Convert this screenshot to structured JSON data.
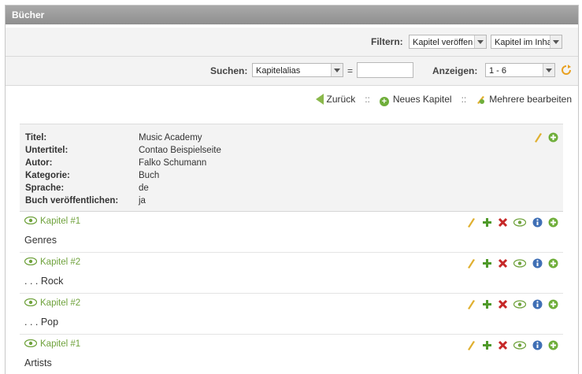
{
  "window": {
    "title": "Bücher"
  },
  "filter": {
    "label": "Filtern:",
    "select1": "Kapitel veröffen",
    "select2": "Kapitel im Inhalt"
  },
  "search": {
    "label": "Suchen:",
    "field_select": "Kapitelalias",
    "equals": "=",
    "value": "",
    "show_label": "Anzeigen:",
    "show_select": "1 - 6"
  },
  "nav": {
    "back": "Zurück",
    "sep1": "::",
    "new_chapter": "Neues Kapitel",
    "sep2": "::",
    "edit_multiple": "Mehrere bearbeiten"
  },
  "book": {
    "rows": [
      {
        "key": "Titel:",
        "value": "Music Academy"
      },
      {
        "key": "Untertitel:",
        "value": "Contao Beispielseite"
      },
      {
        "key": "Autor:",
        "value": "Falko Schumann"
      },
      {
        "key": "Kategorie:",
        "value": "Buch"
      },
      {
        "key": "Sprache:",
        "value": "de"
      },
      {
        "key": "Buch veröffentlichen:",
        "value": "ja"
      }
    ]
  },
  "chapters": [
    {
      "label": "Kapitel #1",
      "title": "Genres"
    },
    {
      "label": "Kapitel #2",
      "title": ". . . Rock"
    },
    {
      "label": "Kapitel #2",
      "title": ". . . Pop"
    },
    {
      "label": "Kapitel #1",
      "title": "Artists"
    }
  ],
  "colors": {
    "accent_green": "#6fa23c",
    "delete_red": "#c62828",
    "info_blue": "#3f6fb5",
    "pencil": "#e0b030"
  }
}
